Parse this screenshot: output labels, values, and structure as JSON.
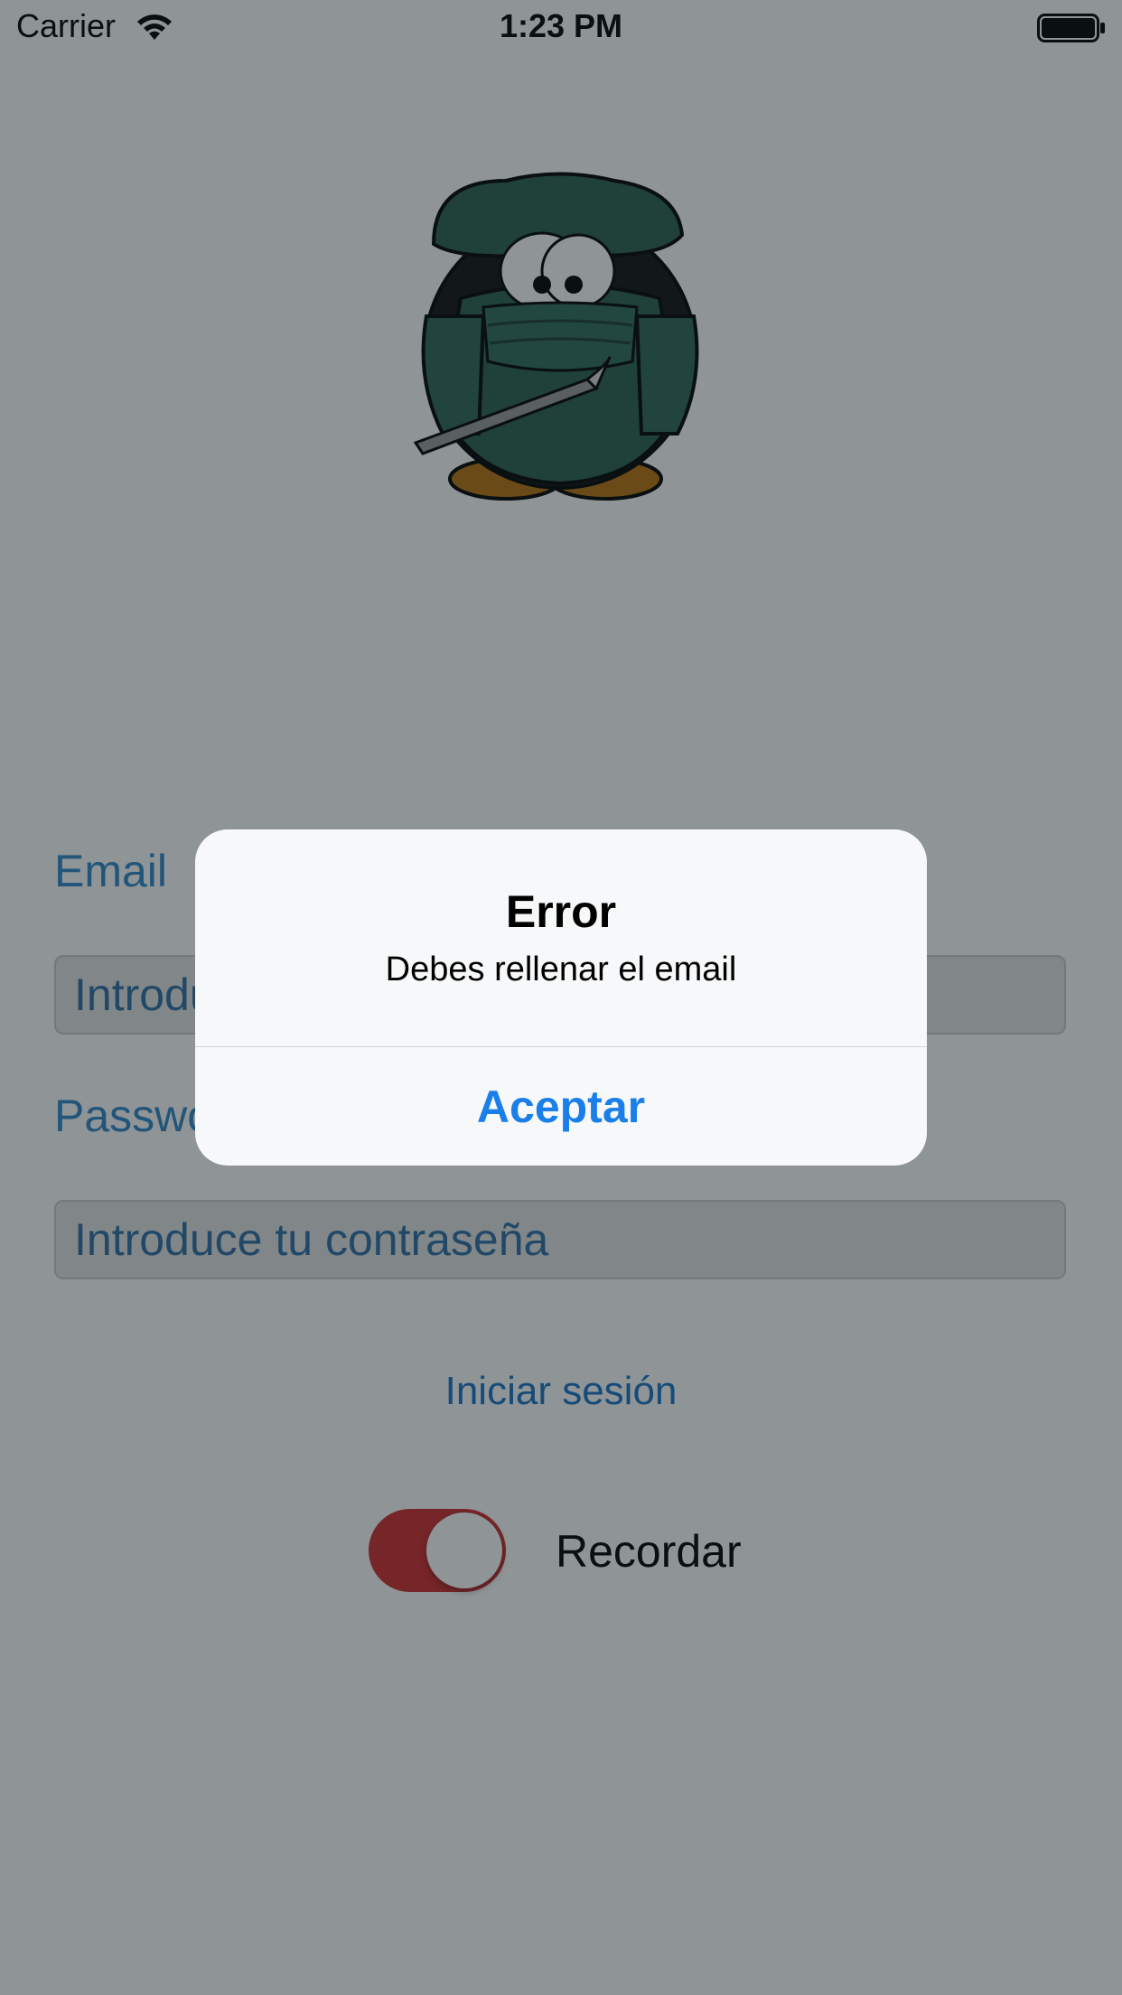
{
  "status_bar": {
    "carrier": "Carrier",
    "time": "1:23 PM",
    "icons": [
      "wifi-icon",
      "battery-icon"
    ]
  },
  "logo": {
    "icon": "surgeon-penguin-logo"
  },
  "form": {
    "email_label": "Email",
    "email_placeholder": "Introduce tu email",
    "email_value": "",
    "password_label": "Password",
    "password_placeholder": "Introduce tu contraseña",
    "password_value": "",
    "login_button": "Iniciar sesión",
    "remember_label": "Recordar",
    "remember_on": true
  },
  "alert": {
    "title": "Error",
    "message": "Debes rellenar el email",
    "button": "Aceptar"
  },
  "colors": {
    "label_blue": "#2f86c8",
    "link_blue": "#1773c7",
    "alert_button_blue": "#1a7fe8",
    "toggle_on": "#d02c2c",
    "scrub_green": "#2b5e4f"
  }
}
